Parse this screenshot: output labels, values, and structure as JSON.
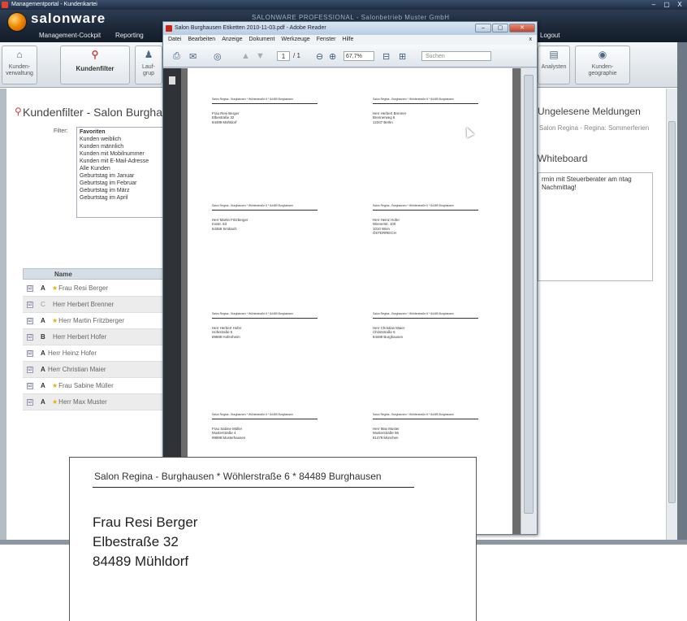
{
  "window": {
    "title": "Managementportal - Kundenkartei",
    "controls": [
      "–",
      "▢",
      "X"
    ]
  },
  "header": {
    "logo": "salonware",
    "product": "SALONWARE PROFESSIONAL - Salonbetrieb Muster GmbH",
    "nav": [
      "Management-Cockpit",
      "Reporting"
    ],
    "logout": "Logout"
  },
  "toolbar": {
    "buttons": [
      {
        "label": "Kunden-\nverwaltung"
      },
      {
        "label": "Kundenfilter"
      },
      {
        "label": "Lauf-\ngrup"
      },
      {
        "label": "Analysten"
      },
      {
        "label": "Kunden-\ngeographie"
      }
    ]
  },
  "kundenfilter": {
    "title": "Kundenfilter - Salon Burgha",
    "filter_label": "Filter:",
    "options": [
      "Favoriten",
      "Kunden weiblich",
      "Kunden männlich",
      "Kunden mit Mobilnummer",
      "Kunden mit E-Mail-Adresse",
      "Alle Kunden",
      "Geburtstag im Januar",
      "Geburtstag im Februar",
      "Geburtstag im März",
      "Geburtstag im April"
    ],
    "selected": "Favoriten"
  },
  "customer_table": {
    "header": "Name",
    "rows": [
      {
        "checked": "☑",
        "group": "A",
        "star": "★",
        "name": "Frau Resi Berger"
      },
      {
        "checked": "☑",
        "group": "C",
        "star": "",
        "name": "Herr Herbert Brenner"
      },
      {
        "checked": "☑",
        "group": "A",
        "star": "★",
        "name": "Herr Martin Fritzberger"
      },
      {
        "checked": "☑",
        "group": "B",
        "star": "",
        "name": "Herr Herbert Hofer"
      },
      {
        "checked": "☑",
        "group": "A",
        "star": "",
        "name": "Herr Heinz Hofer"
      },
      {
        "checked": "☑",
        "group": "A",
        "star": "",
        "name": "Herr Christian Maier"
      },
      {
        "checked": "☑",
        "group": "A",
        "star": "★",
        "name": "Frau Sabine Müller"
      },
      {
        "checked": "☑",
        "group": "A",
        "star": "★",
        "name": "Herr Max Muster"
      }
    ]
  },
  "right": {
    "messages_title": "Ungelesene Meldungen",
    "message": "Salon Regina - Regina: Sommerferien",
    "whiteboard_title": "Whiteboard",
    "whiteboard_text": "rmin mit Steuerberater am ntag Nachmittag!"
  },
  "reader": {
    "title": "Salon Burghausen Etiketten 2010-11-03.pdf - Adobe Reader",
    "menu": [
      "Datei",
      "Bearbeiten",
      "Anzeige",
      "Dokument",
      "Werkzeuge",
      "Fenster",
      "Hilfe"
    ],
    "menu_close": "x",
    "page": "1",
    "page_count": "/ 1",
    "zoom": "67,7%",
    "search_placeholder": "Suchen",
    "sender": "Salon Regina - Burghausen * Wöhlerstraße 6 * 84489 Burghausen",
    "labels": [
      [
        "Frau Resi Berger",
        "Elbestraße 32",
        "84489 Mühldorf"
      ],
      [
        "Herr Herbert Brenner",
        "Brennerweg 6",
        "12347 Berlin"
      ],
      [
        "Herr Martin Fritzberger",
        "Innstr. 63",
        "84359 Simbach"
      ],
      [
        "Herr Heinz Hofer",
        "Wienerstr. 100",
        "1010 Wien",
        "ÖSTERREICH"
      ],
      [
        "Herr Herbert Hofer",
        "Hofestraße 5",
        "89989 Hofenheim"
      ],
      [
        "Herr Christian Maier",
        "Christstraße 6",
        "84489 Burghausen"
      ],
      [
        "Frau Sabine Müller",
        "Musterstraße 4",
        "99999 Musterhausen"
      ],
      [
        "Herr Max Muster",
        "Musterstraße 66",
        "81479 München"
      ]
    ]
  },
  "zoom": {
    "sender": "Salon Regina - Burghausen * Wöhlerstraße 6 * 84489 Burghausen",
    "address": [
      "Frau Resi Berger",
      "Elbestraße 32",
      "84489 Mühldorf"
    ]
  }
}
